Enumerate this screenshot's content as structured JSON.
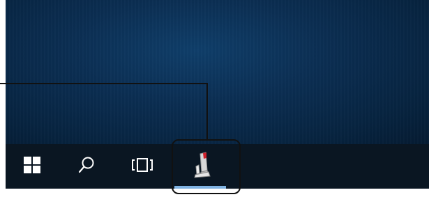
{
  "desktop": {
    "background": "#0b2e52"
  },
  "taskbar": {
    "background": "#0a1622",
    "items": [
      {
        "icon": "windows-logo-icon"
      },
      {
        "icon": "search-icon"
      },
      {
        "icon": "task-view-icon"
      },
      {
        "icon": "app-icon",
        "active": true
      }
    ],
    "active_indicator_color": "#7fb2e2"
  },
  "callout": {
    "color": "#111111"
  }
}
